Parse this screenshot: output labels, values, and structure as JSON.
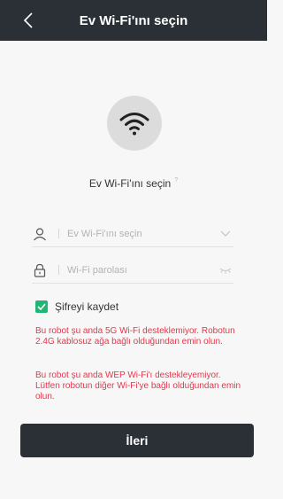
{
  "header": {
    "title": "Ev Wi-Fi'ını seçin",
    "back_icon": "chevron-left-icon"
  },
  "wifi_icon": "wifi-icon",
  "prompt": {
    "text": "Ev Wi-Fi'ını seçin",
    "help_mark": "?"
  },
  "ssid_field": {
    "placeholder": "Ev Wi-Fi'ını seçin",
    "value": "",
    "leading_icon": "user-icon",
    "trailing_icon": "chevron-down-icon"
  },
  "password_field": {
    "placeholder": "Wi-Fi parolası",
    "value": "",
    "leading_icon": "lock-icon",
    "trailing_icon": "eye-closed-icon"
  },
  "remember": {
    "label": "Şifreyi kaydet",
    "checked": true
  },
  "warnings": {
    "five_ghz": "Bu robot şu anda 5G Wi-Fi desteklemiyor. Robotun 2.4G kablosuz ağa bağlı olduğundan emin olun.",
    "wep": "Bu robot şu anda WEP Wi-Fi'ı destekleyemiyor. Lütfen robotun diğer Wi-Fi'ye bağlı olduğundan emin olun."
  },
  "next_button": {
    "label": "İleri"
  },
  "colors": {
    "header_bg": "#2b3036",
    "accent_green": "#22b573",
    "warning_red": "#e8364a",
    "page_bg": "#f7f7f7"
  }
}
